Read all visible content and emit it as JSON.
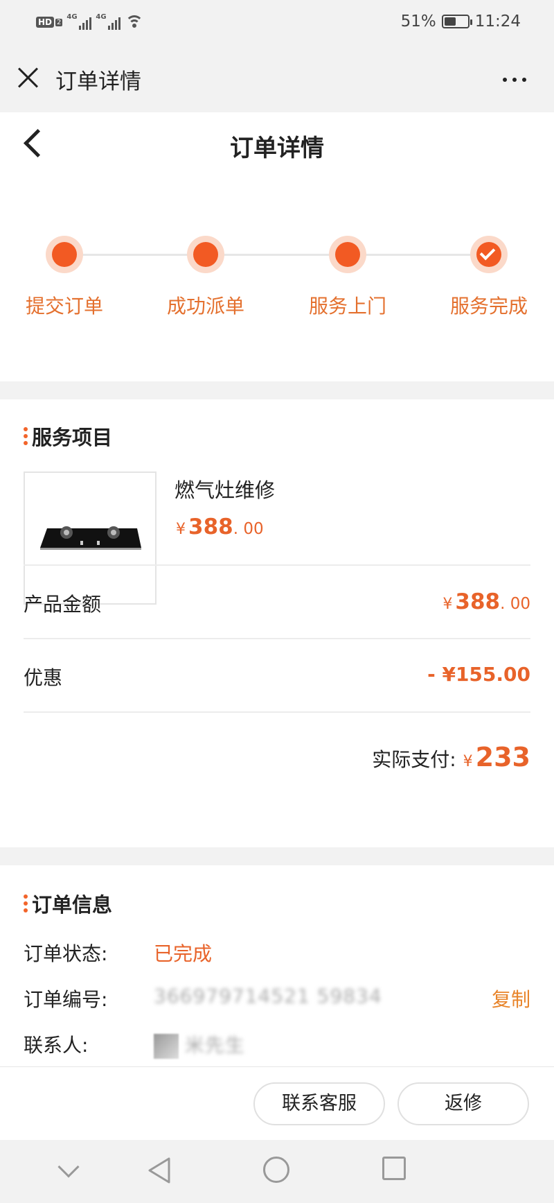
{
  "status_bar": {
    "hd": "HD",
    "hd_sub": "2",
    "net1": "4G",
    "net2": "4G",
    "battery": "51%",
    "time": "11:24"
  },
  "web_header": {
    "title": "订单详情"
  },
  "page": {
    "title": "订单详情"
  },
  "steps": [
    {
      "label": "提交订单",
      "state": "done"
    },
    {
      "label": "成功派单",
      "state": "done"
    },
    {
      "label": "服务上门",
      "state": "done"
    },
    {
      "label": "服务完成",
      "state": "complete"
    }
  ],
  "service": {
    "section_title": "服务项目",
    "product_name": "燃气灶维修",
    "currency": "¥",
    "product_price_int": "388",
    "product_price_dec": ". 00",
    "amount_label": "产品金额",
    "amount_int": "388",
    "amount_dec": ". 00",
    "discount_label": "优惠",
    "discount_value": "- ¥155.00",
    "paid_label": "实际支付:",
    "paid_value": "233"
  },
  "info": {
    "section_title": "订单信息",
    "status_label": "订单状态:",
    "status_value": "已完成",
    "order_no_label": "订单编号:",
    "order_no_value": "366979714521 59834",
    "copy_label": "复制",
    "contact_label": "联系人:",
    "contact_value": "米先生"
  },
  "actions": {
    "contact_service": "联系客服",
    "repair_again": "返修"
  },
  "colors": {
    "accent": "#f25a23",
    "accent_text": "#e8632a",
    "step_label": "#e4702e"
  }
}
